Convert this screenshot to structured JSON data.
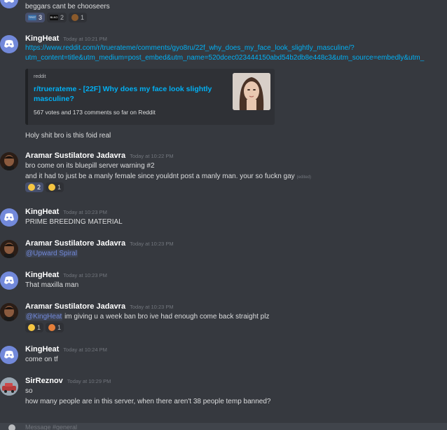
{
  "messages": [
    {
      "lines": [
        "beggars cant be chooseers"
      ],
      "reactions": [
        {
          "icon": "text-emoji-icon",
          "label": "TRST",
          "count": "3",
          "color": "#3b6ea5"
        },
        {
          "icon": "image-emoji-icon",
          "label": "BLKO",
          "count": "2",
          "color": "#101010"
        },
        {
          "icon": "poop-emoji-icon",
          "label": "",
          "count": "1",
          "color": "#8b5a2b"
        }
      ]
    },
    {
      "author": "KingHeat",
      "timestamp": "Today at 10:21 PM",
      "link_lines": [
        "https://www.reddit.com/r/truerateme/comments/gyo8ru/22f_why_does_my_face_look_slightly_masculine/?",
        "utm_content=title&utm_medium=post_embed&utm_name=520dcec023444150abd54b2db8e448c3&utm_source=embedly&utm_"
      ],
      "embed": {
        "provider": "reddit",
        "title": "r/truerateme - [22F] Why does my face look slightly masculine?",
        "description": "567 votes and 173 comments so far on Reddit"
      },
      "lines": [
        "Holy shit bro is this foid real"
      ]
    },
    {
      "author": "Aramar Sustilatore Jadavra",
      "timestamp": "Today at 10:22 PM",
      "lines": [
        "bro come on its bluepill server warning #2",
        "and it had to just be a manly female since youldnt post a manly man. your so fuckn gay"
      ],
      "edited": "(edited)",
      "reactions": [
        {
          "icon": "rofl-emoji-icon",
          "count": "2",
          "color": "#f5c542",
          "me": true
        },
        {
          "icon": "sad-emoji-icon",
          "count": "1",
          "color": "#f5c542"
        }
      ]
    },
    {
      "author": "KingHeat",
      "timestamp": "Today at 10:23 PM",
      "lines": [
        "PRIME BREEDING MATERIAL"
      ]
    },
    {
      "author": "Aramar Sustilatore Jadavra",
      "timestamp": "Today at 10:23 PM",
      "mention": "@Upward Spiral"
    },
    {
      "author": "KingHeat",
      "timestamp": "Today at 10:23 PM",
      "lines": [
        "That maxilla man"
      ]
    },
    {
      "author": "Aramar Sustilatore Jadavra",
      "timestamp": "Today at 10:23 PM",
      "mention": "@KingHeat",
      "mention_rest": " im giving  u a week ban bro ive had enough come back straight plz",
      "reactions": [
        {
          "icon": "grin-cat-emoji-icon",
          "count": "1",
          "color": "#f5c542"
        },
        {
          "icon": "syringe-emoji-icon",
          "count": "1",
          "color": "#e57f3a"
        }
      ]
    },
    {
      "author": "KingHeat",
      "timestamp": "Today at 10:24 PM",
      "lines": [
        "come on tf"
      ]
    },
    {
      "author": "SirReznov",
      "timestamp": "Today at 10:29 PM",
      "lines": [
        "so",
        "how many people are in this server, when there aren't 38 people temp banned?"
      ]
    }
  ],
  "composer": {
    "placeholder": "Message #general"
  },
  "colors": {
    "background": "#36393f",
    "link": "#00b0f4",
    "mention": "#7289da",
    "discord_avatar": "#7289da"
  }
}
